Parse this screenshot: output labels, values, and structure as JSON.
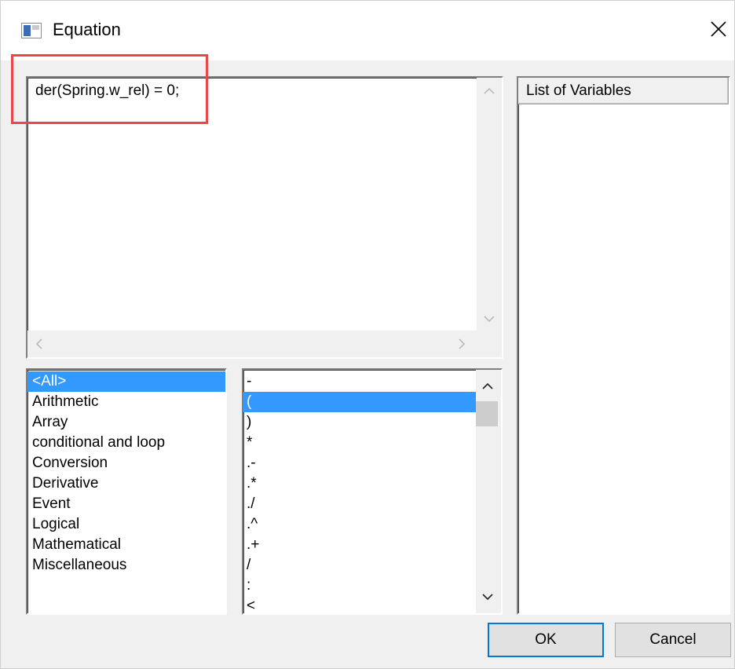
{
  "window": {
    "title": "Equation",
    "close_glyph": "✕"
  },
  "editor": {
    "text": "der(Spring.w_rel) = 0;"
  },
  "categories": {
    "items": [
      "<All>",
      "Arithmetic",
      "Array",
      "conditional and loop",
      "Conversion",
      "Derivative",
      "Event",
      "Logical",
      "Mathematical",
      "Miscellaneous"
    ],
    "selected": "<All>"
  },
  "operators": {
    "items": [
      "-",
      "(",
      ")",
      "*",
      ".-",
      ".*",
      "./",
      ".^",
      ".+",
      "/",
      ":",
      "<"
    ],
    "selected": "("
  },
  "variables": {
    "header": "List of Variables"
  },
  "buttons": {
    "ok": "OK",
    "cancel": "Cancel"
  },
  "icons": {
    "scroll_up": "chevron-up-icon",
    "scroll_down": "chevron-down-icon",
    "scroll_left": "chevron-left-icon",
    "scroll_right": "chevron-right-icon",
    "app": "app-window-icon",
    "close": "close-icon"
  },
  "colors": {
    "selection": "#3399ff",
    "highlight_annotation": "#e8474b",
    "ok_focus_border": "#0078d7"
  }
}
